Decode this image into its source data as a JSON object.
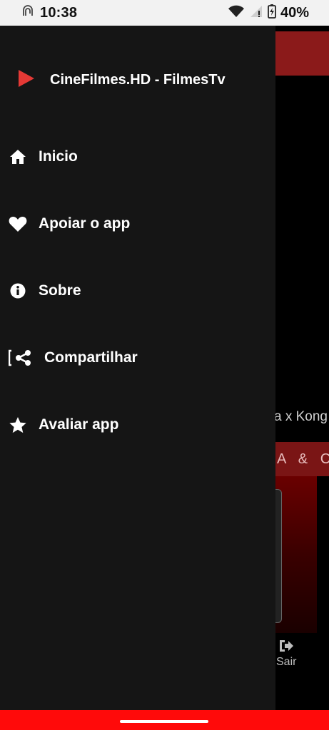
{
  "status_bar": {
    "time": "10:38",
    "battery": "40%",
    "icons": [
      "nfc-icon",
      "wifi-icon",
      "signal-icon",
      "battery-icon"
    ]
  },
  "drawer": {
    "app_title": "CineFilmes.HD - FilmesTv",
    "logo_color": "#e53935",
    "items": [
      {
        "label": "Inicio",
        "icon": "home-icon"
      },
      {
        "label": "Apoiar o app",
        "icon": "heart-icon"
      },
      {
        "label": "Sobre",
        "icon": "info-icon"
      },
      {
        "label": "Compartilhar",
        "icon": "share-icon"
      },
      {
        "label": "Avaliar app",
        "icon": "star-icon"
      }
    ]
  },
  "background": {
    "text_fragment": "a x Kong",
    "strip_text": "A & CO",
    "exit_label": "Sair"
  },
  "colors": {
    "drawer_bg": "#151515",
    "accent_red": "#ff0a0a",
    "appbar_red": "#8b1a1a"
  }
}
